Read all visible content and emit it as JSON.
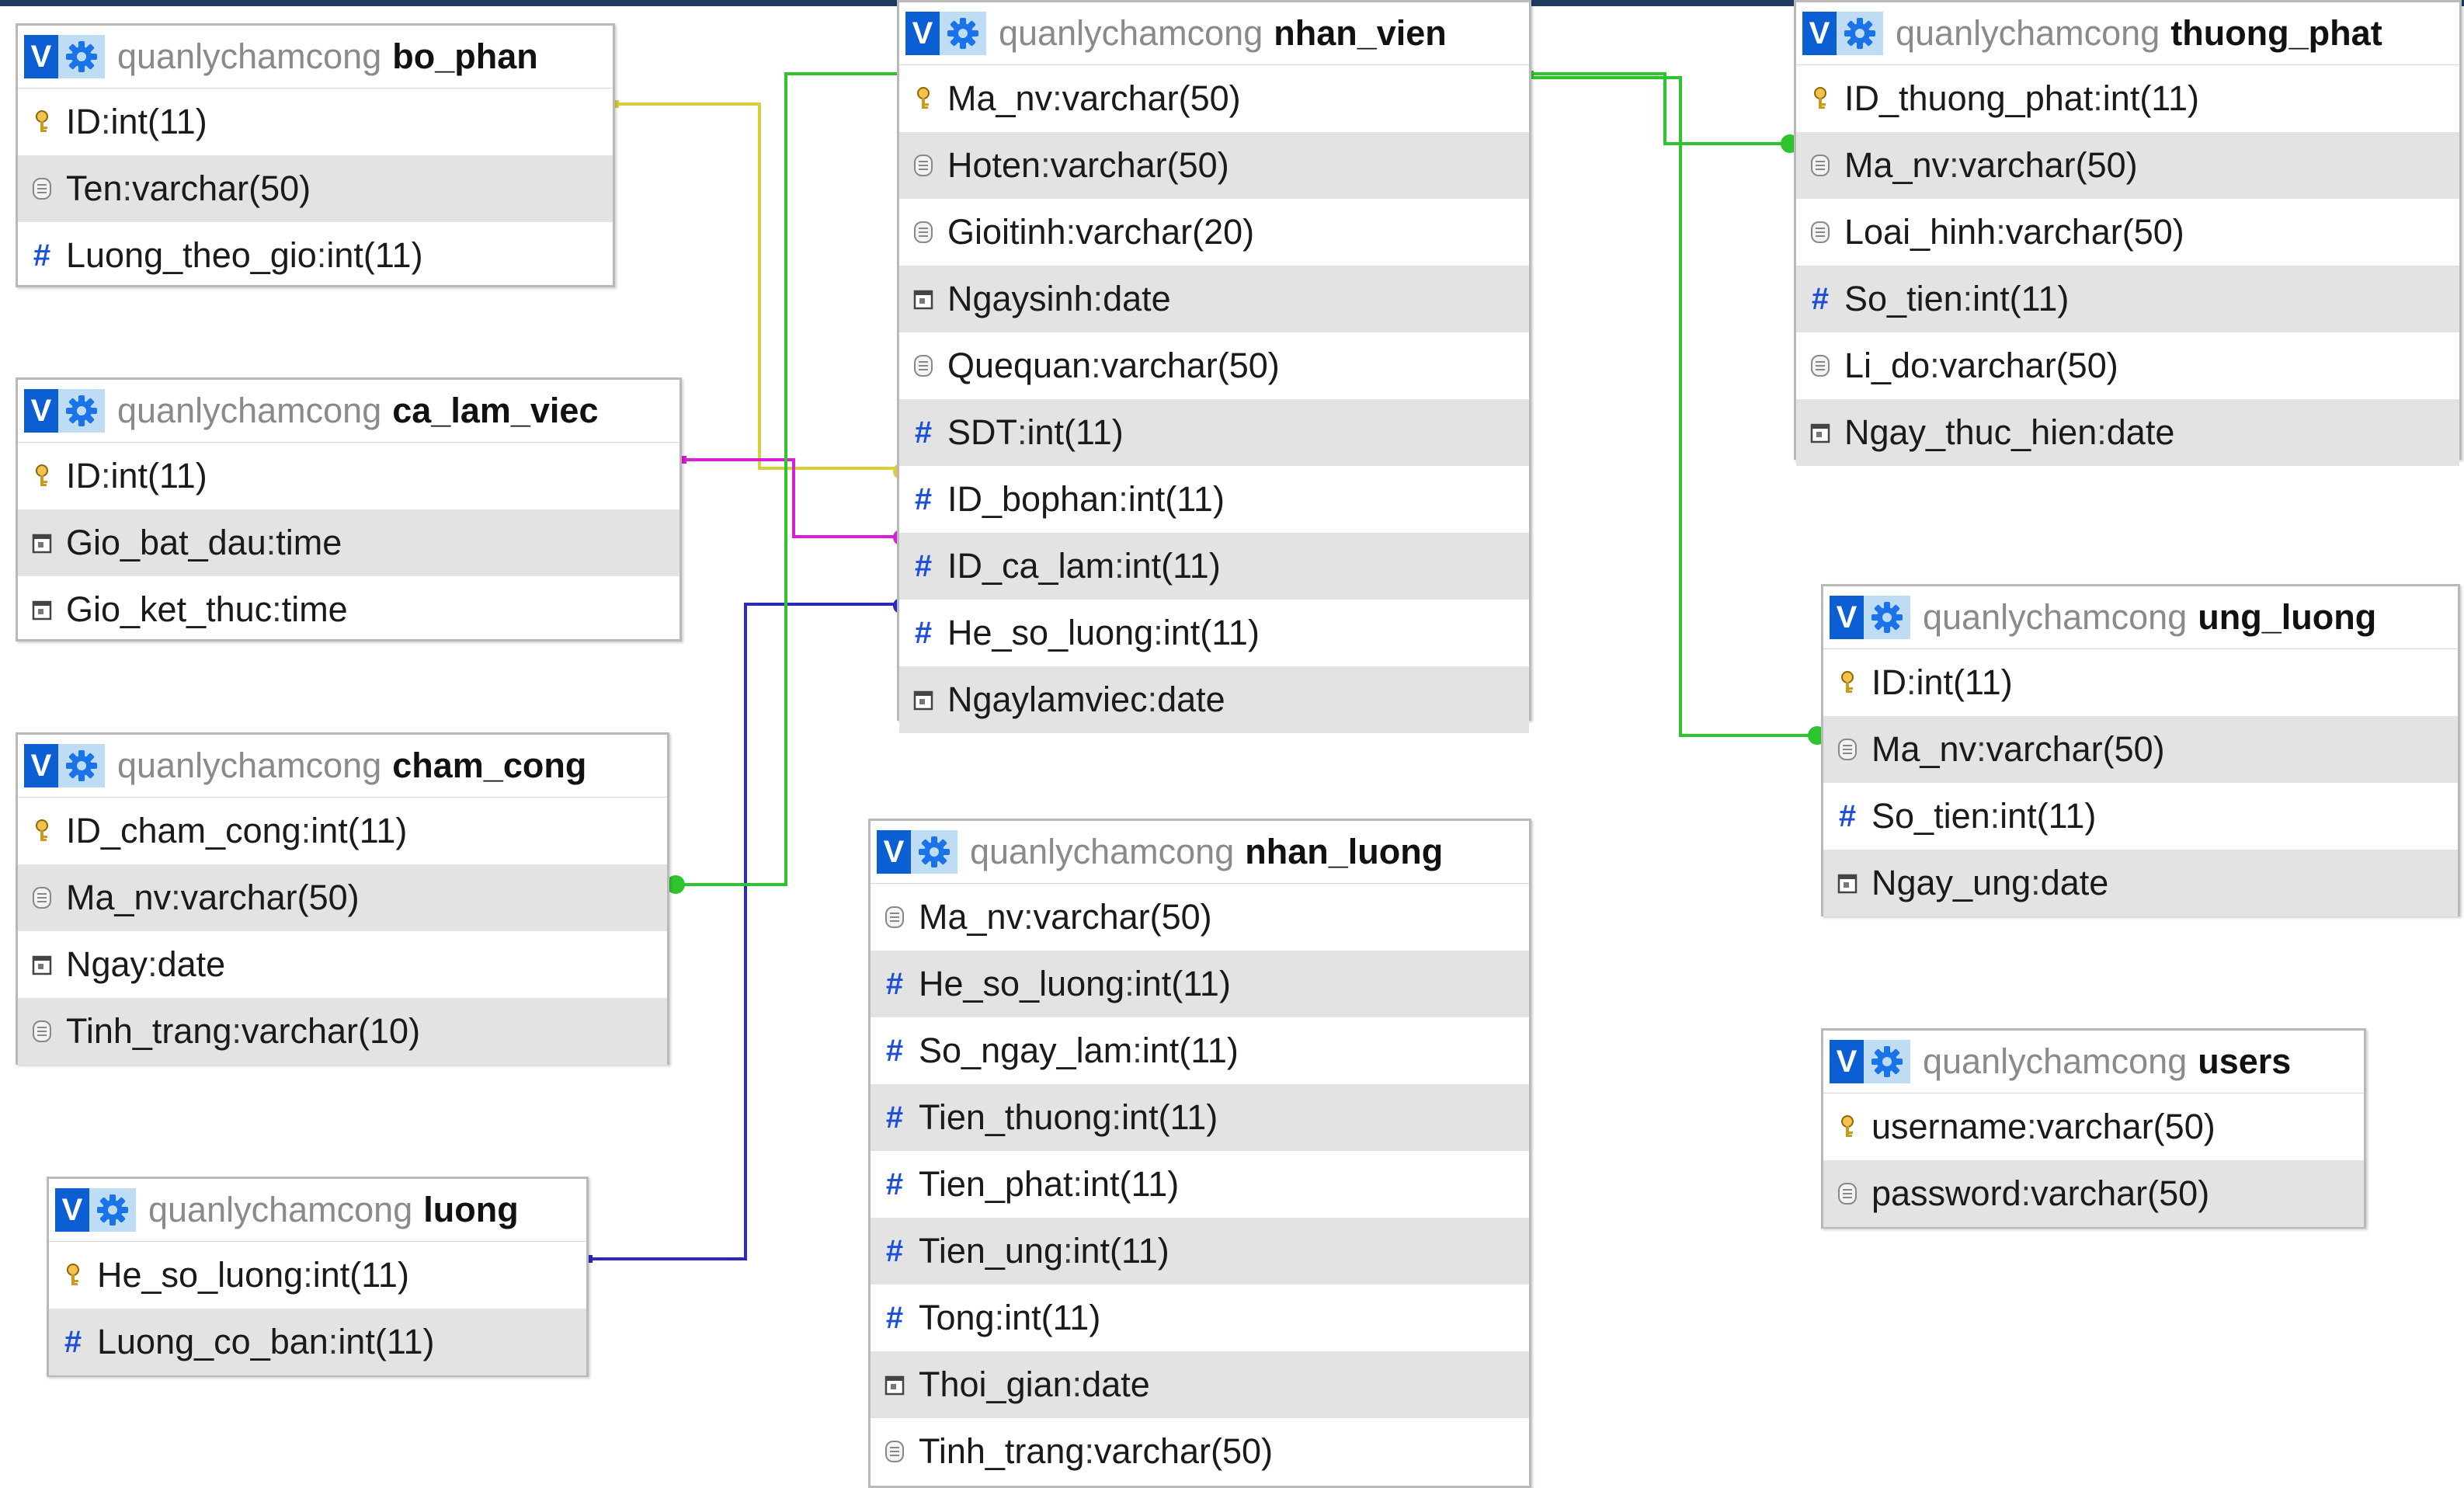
{
  "tables": {
    "bo_phan": {
      "db": "quanlychamcong",
      "name": "bo_phan",
      "fields": [
        {
          "name": "ID",
          "type": "int(11)",
          "icon": "key-icon"
        },
        {
          "name": "Ten",
          "type": "varchar(50)",
          "icon": "text-icon"
        },
        {
          "name": "Luong_theo_gio",
          "type": "int(11)",
          "icon": "hash-icon"
        }
      ]
    },
    "ca_lam_viec": {
      "db": "quanlychamcong",
      "name": "ca_lam_viec",
      "fields": [
        {
          "name": "ID",
          "type": "int(11)",
          "icon": "key-icon"
        },
        {
          "name": "Gio_bat_dau",
          "type": "time",
          "icon": "calendar-icon"
        },
        {
          "name": "Gio_ket_thuc",
          "type": "time",
          "icon": "calendar-icon"
        }
      ]
    },
    "cham_cong": {
      "db": "quanlychamcong",
      "name": "cham_cong",
      "fields": [
        {
          "name": "ID_cham_cong",
          "type": "int(11)",
          "icon": "key-icon"
        },
        {
          "name": "Ma_nv",
          "type": "varchar(50)",
          "icon": "text-icon"
        },
        {
          "name": "Ngay",
          "type": "date",
          "icon": "calendar-icon"
        },
        {
          "name": "Tinh_trang",
          "type": "varchar(10)",
          "icon": "text-icon"
        }
      ]
    },
    "luong": {
      "db": "quanlychamcong",
      "name": "luong",
      "fields": [
        {
          "name": "He_so_luong",
          "type": "int(11)",
          "icon": "key-icon"
        },
        {
          "name": "Luong_co_ban",
          "type": "int(11)",
          "icon": "hash-icon"
        }
      ]
    },
    "nhan_vien": {
      "db": "quanlychamcong",
      "name": "nhan_vien",
      "fields": [
        {
          "name": "Ma_nv",
          "type": "varchar(50)",
          "icon": "key-icon"
        },
        {
          "name": "Hoten",
          "type": "varchar(50)",
          "icon": "text-icon"
        },
        {
          "name": "Gioitinh",
          "type": "varchar(20)",
          "icon": "text-icon"
        },
        {
          "name": "Ngaysinh",
          "type": "date",
          "icon": "calendar-icon"
        },
        {
          "name": "Quequan",
          "type": "varchar(50)",
          "icon": "text-icon"
        },
        {
          "name": "SDT",
          "type": "int(11)",
          "icon": "hash-icon"
        },
        {
          "name": "ID_bophan",
          "type": "int(11)",
          "icon": "hash-icon"
        },
        {
          "name": "ID_ca_lam",
          "type": "int(11)",
          "icon": "hash-icon"
        },
        {
          "name": "He_so_luong",
          "type": "int(11)",
          "icon": "hash-icon"
        },
        {
          "name": "Ngaylamviec",
          "type": "date",
          "icon": "calendar-icon"
        }
      ]
    },
    "nhan_luong": {
      "db": "quanlychamcong",
      "name": "nhan_luong",
      "fields": [
        {
          "name": "Ma_nv",
          "type": "varchar(50)",
          "icon": "text-icon"
        },
        {
          "name": "He_so_luong",
          "type": "int(11)",
          "icon": "hash-icon"
        },
        {
          "name": "So_ngay_lam",
          "type": "int(11)",
          "icon": "hash-icon"
        },
        {
          "name": "Tien_thuong",
          "type": "int(11)",
          "icon": "hash-icon"
        },
        {
          "name": "Tien_phat",
          "type": "int(11)",
          "icon": "hash-icon"
        },
        {
          "name": "Tien_ung",
          "type": "int(11)",
          "icon": "hash-icon"
        },
        {
          "name": "Tong",
          "type": "int(11)",
          "icon": "hash-icon"
        },
        {
          "name": "Thoi_gian",
          "type": "date",
          "icon": "calendar-icon"
        },
        {
          "name": "Tinh_trang",
          "type": "varchar(50)",
          "icon": "text-icon"
        }
      ]
    },
    "thuong_phat": {
      "db": "quanlychamcong",
      "name": "thuong_phat",
      "fields": [
        {
          "name": "ID_thuong_phat",
          "type": "int(11)",
          "icon": "key-icon"
        },
        {
          "name": "Ma_nv",
          "type": "varchar(50)",
          "icon": "text-icon"
        },
        {
          "name": "Loai_hinh",
          "type": "varchar(50)",
          "icon": "text-icon"
        },
        {
          "name": "So_tien",
          "type": "int(11)",
          "icon": "hash-icon"
        },
        {
          "name": "Li_do",
          "type": "varchar(50)",
          "icon": "text-icon"
        },
        {
          "name": "Ngay_thuc_hien",
          "type": "date",
          "icon": "calendar-icon"
        }
      ]
    },
    "ung_luong": {
      "db": "quanlychamcong",
      "name": "ung_luong",
      "fields": [
        {
          "name": "ID",
          "type": "int(11)",
          "icon": "key-icon"
        },
        {
          "name": "Ma_nv",
          "type": "varchar(50)",
          "icon": "text-icon"
        },
        {
          "name": "So_tien",
          "type": "int(11)",
          "icon": "hash-icon"
        },
        {
          "name": "Ngay_ung",
          "type": "date",
          "icon": "calendar-icon"
        }
      ]
    },
    "users": {
      "db": "quanlychamcong",
      "name": "users",
      "fields": [
        {
          "name": "username",
          "type": "varchar(50)",
          "icon": "key-icon"
        },
        {
          "name": "password",
          "type": "varchar(50)",
          "icon": "text-icon"
        }
      ]
    }
  },
  "ui": {
    "v_label": "V",
    "settings_icon": "gear-icon",
    "separator": " : "
  },
  "colors": {
    "link_bo_phan": "#d6cf3a",
    "link_ca_lam_viec": "#d61fd6",
    "link_luong": "#2a2ab8",
    "link_ma_nv": "#2ec42e"
  }
}
